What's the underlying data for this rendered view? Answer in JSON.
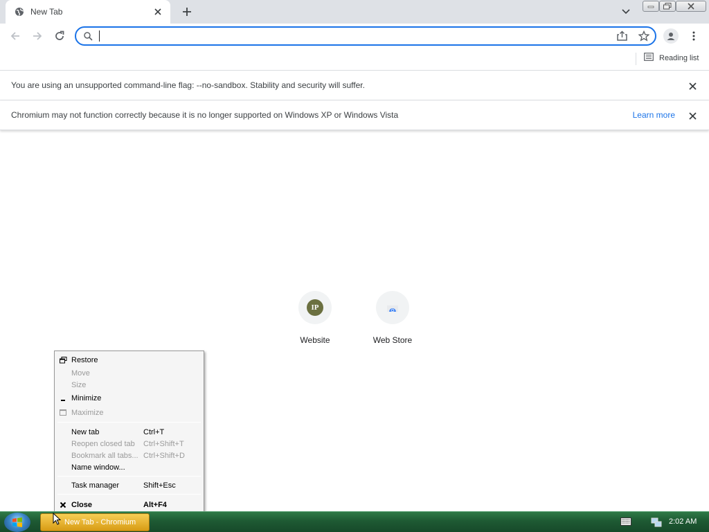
{
  "tab": {
    "title": "New Tab"
  },
  "omnibox": {
    "value": "",
    "placeholder": ""
  },
  "bookmarks": {
    "reading_list": "Reading list"
  },
  "infobars": [
    {
      "text": "You are using an unsupported command-line flag: --no-sandbox. Stability and security will suffer."
    },
    {
      "text": "Chromium may not function correctly because it is no longer supported on Windows XP or Windows Vista",
      "link": "Learn more"
    }
  ],
  "shortcuts": [
    {
      "label": "Website",
      "icon_text": "IP"
    },
    {
      "label": "Web Store"
    }
  ],
  "context_menu": {
    "items": [
      {
        "label": "Restore",
        "shortcut": "",
        "enabled": true
      },
      {
        "label": "Move",
        "shortcut": "",
        "enabled": false
      },
      {
        "label": "Size",
        "shortcut": "",
        "enabled": false
      },
      {
        "label": "Minimize",
        "shortcut": "",
        "enabled": true
      },
      {
        "label": "Maximize",
        "shortcut": "",
        "enabled": false
      },
      {
        "label": "New tab",
        "shortcut": "Ctrl+T",
        "enabled": true
      },
      {
        "label": "Reopen closed tab",
        "shortcut": "Ctrl+Shift+T",
        "enabled": false
      },
      {
        "label": "Bookmark all tabs...",
        "shortcut": "Ctrl+Shift+D",
        "enabled": false
      },
      {
        "label": "Name window...",
        "shortcut": "",
        "enabled": true
      },
      {
        "label": "Task manager",
        "shortcut": "Shift+Esc",
        "enabled": true
      },
      {
        "label": "Close",
        "shortcut": "Alt+F4",
        "enabled": true
      }
    ]
  },
  "taskbar": {
    "task_label": "New Tab - Chromium",
    "clock": "2:02 AM"
  },
  "colors": {
    "accent": "#1a73e8",
    "taskbar": "#1e5a33",
    "task_active": "#e9b531"
  }
}
